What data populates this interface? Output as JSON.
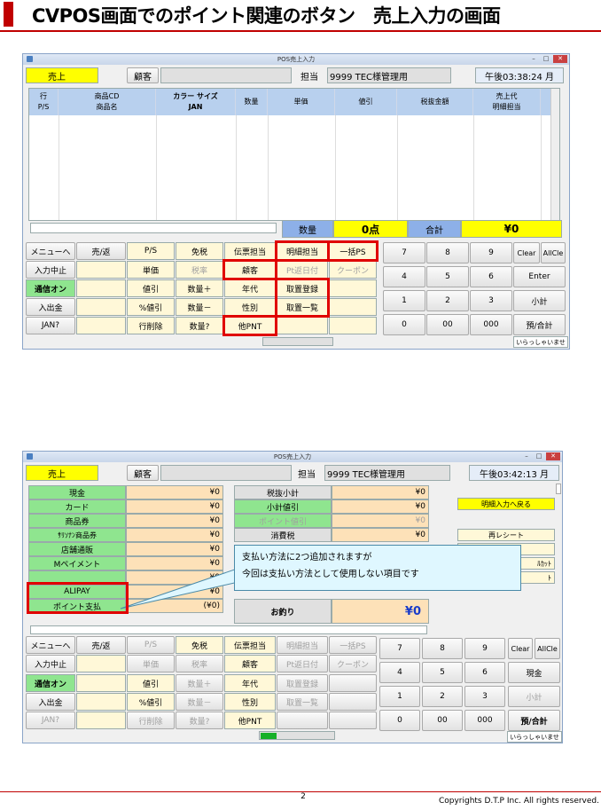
{
  "heading": {
    "title": "CVPOS画面でのポイント関連のボタン　売上入力の画面"
  },
  "window_top": {
    "title": "POS売上入力",
    "mode": "売上",
    "customer_label": "顧客",
    "staff_label": "担当",
    "staff_value": "9999 TEC様管理用",
    "time": "午後03:38:24 月",
    "columns": [
      {
        "l1": "行",
        "l2": "P/S"
      },
      {
        "l1": "商品CD",
        "l2": "商品名"
      },
      {
        "l1": "カラー サイズ",
        "l2": "JAN"
      },
      {
        "l1": "数量",
        "l2": ""
      },
      {
        "l1": "単価",
        "l2": ""
      },
      {
        "l1": "値引",
        "l2": ""
      },
      {
        "l1": "税抜金額",
        "l2": ""
      },
      {
        "l1": "売上代",
        "l2": "明細担当"
      }
    ],
    "qty_label": "数量",
    "qty_value": "0点",
    "total_label": "合計",
    "total_value": "¥0",
    "left_buttons": [
      "メニューへ",
      "入力中止",
      "通信オン",
      "入出金",
      "JAN?"
    ],
    "uriage_henpin": "売/返",
    "grid": [
      [
        "P/S",
        "免税",
        "伝票担当",
        "明細担当",
        "一括PS"
      ],
      [
        "単価",
        "税率",
        "顧客",
        "Pt返日付",
        "クーポン"
      ],
      [
        "値引",
        "数量＋",
        "年代",
        "取置登録",
        ""
      ],
      [
        "%値引",
        "数量－",
        "性別",
        "取置一覧",
        ""
      ],
      [
        "行削除",
        "数量?",
        "他PNT",
        "",
        ""
      ]
    ],
    "keypad": [
      [
        "7",
        "8",
        "9",
        "Clear",
        "AllCle"
      ],
      [
        "4",
        "5",
        "6",
        "Enter"
      ],
      [
        "1",
        "2",
        "3",
        "小計"
      ],
      [
        "0",
        "00",
        "000",
        "預/合計"
      ]
    ],
    "status": "いらっしゃいませ"
  },
  "window_bottom": {
    "title": "POS売上入力",
    "mode": "売上",
    "customer_label": "顧客",
    "staff_label": "担当",
    "staff_value": "9999 TEC様管理用",
    "time": "午後03:42:13 月",
    "pay_methods": [
      {
        "label": "現金",
        "amount": "¥0"
      },
      {
        "label": "カード",
        "amount": "¥0"
      },
      {
        "label": "商品券",
        "amount": "¥0"
      },
      {
        "label": "ｻﾘｿﾅﾝ商品券",
        "amount": "¥0"
      },
      {
        "label": "店舗通販",
        "amount": "¥0"
      },
      {
        "label": "Mペイメント",
        "amount": "¥0"
      },
      {
        "label": "",
        "amount": "¥0"
      },
      {
        "label": "ALIPAY",
        "amount": "¥0"
      },
      {
        "label": "ポイント支払",
        "amount": "(¥0)"
      }
    ],
    "summary": [
      {
        "label": "税抜小計",
        "amount": "¥0"
      },
      {
        "label": "小計値引",
        "amount": "¥0"
      },
      {
        "label": "ポイント値引",
        "amount": "¥0"
      },
      {
        "label": "消費税",
        "amount": "¥0"
      }
    ],
    "change_label": "お釣り",
    "change_value": "¥0",
    "right_buttons": [
      "明細入力へ戻る",
      "再レシート",
      "",
      "ﾙｶｯﾄ",
      "ﾄ"
    ],
    "callout_line1": "支払い方法に2つ追加されますが",
    "callout_line2": "今回は支払い方法として使用しない項目です",
    "left_buttons": [
      "メニューへ",
      "入力中止",
      "通信オン",
      "入出金",
      "JAN?"
    ],
    "uriage_henpin": "売/返",
    "grid": [
      [
        "P/S",
        "免税",
        "伝票担当",
        "明細担当",
        "一括PS"
      ],
      [
        "単価",
        "税率",
        "顧客",
        "Pt返日付",
        "クーポン"
      ],
      [
        "値引",
        "数量＋",
        "年代",
        "取置登録",
        ""
      ],
      [
        "%値引",
        "数量－",
        "性別",
        "取置一覧",
        ""
      ],
      [
        "行削除",
        "数量?",
        "他PNT",
        "",
        ""
      ]
    ],
    "keypad": [
      [
        "7",
        "8",
        "9",
        "Clear",
        "AllCle"
      ],
      [
        "4",
        "5",
        "6",
        "現金"
      ],
      [
        "1",
        "2",
        "3",
        "小計"
      ],
      [
        "0",
        "00",
        "000",
        "預/合計"
      ]
    ],
    "status": "いらっしゃいませ"
  },
  "footer": {
    "page": "2",
    "copyright": "Copyrights  D.T.P Inc. All rights reserved."
  },
  "colors": {
    "accent_red": "#c00000",
    "highlight_yellow": "#ffff00",
    "pay_green": "#8fe58f",
    "header_blue": "#b8d0ee"
  }
}
